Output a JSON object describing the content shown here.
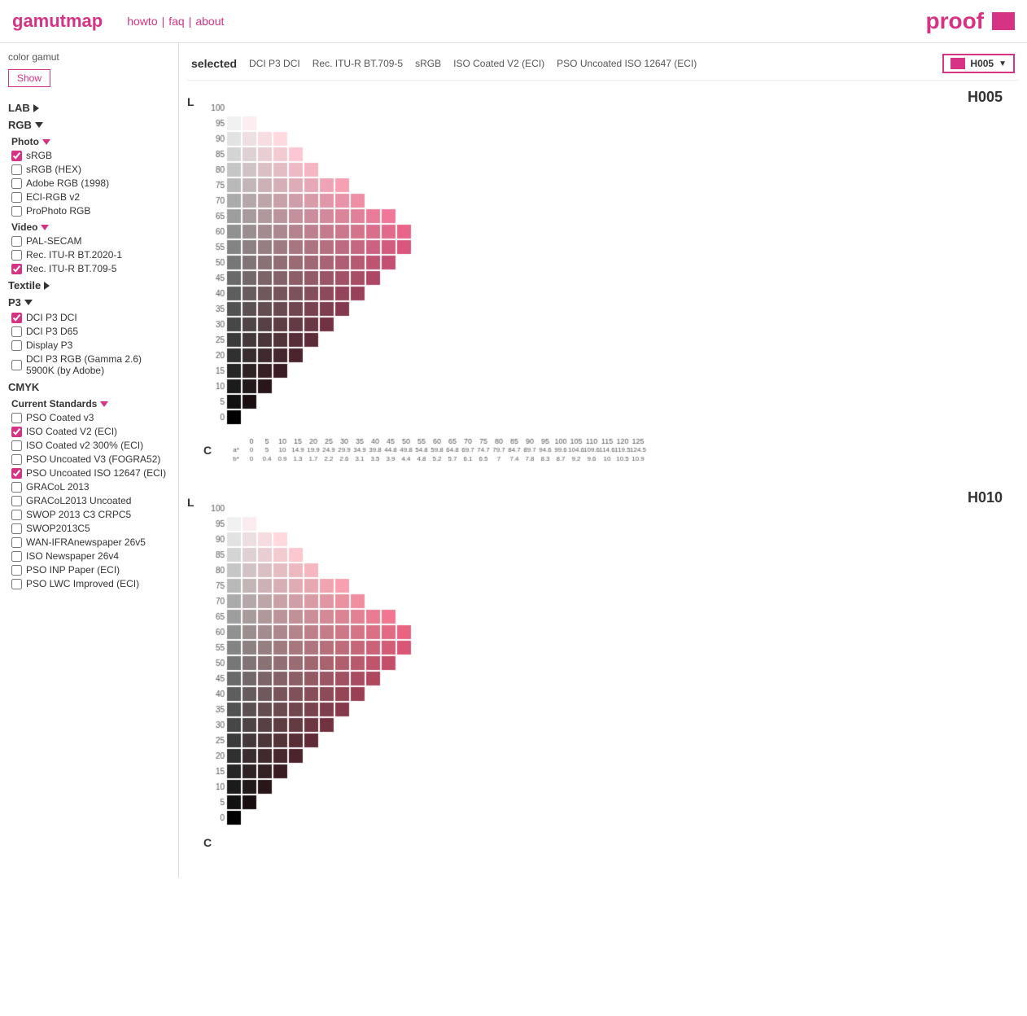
{
  "app": {
    "logo": "gamutmap",
    "nav": {
      "howto": "howto",
      "sep1": "|",
      "faq": "faq",
      "sep2": "|",
      "about": "about"
    },
    "proof": "proof"
  },
  "header": {
    "color_gamut_label": "color gamut",
    "show_button": "Show",
    "selected_label": "selected",
    "gamut_tags": [
      "DCI P3 DCI",
      "Rec. ITU-R BT.709-5",
      "sRGB",
      "ISO Coated V2 (ECI)",
      "PSO Uncoated ISO 12647 (ECI)"
    ],
    "hue_selector": {
      "label": "H005",
      "arrow": "▼"
    }
  },
  "sidebar": {
    "sections": [
      {
        "name": "LAB",
        "expanded": false,
        "arrow": "right"
      },
      {
        "name": "RGB",
        "expanded": true,
        "arrow": "down",
        "subsections": [
          {
            "name": "Photo",
            "expanded": true,
            "arrow": "down-pink",
            "items": [
              {
                "label": "sRGB",
                "checked": true
              },
              {
                "label": "sRGB (HEX)",
                "checked": false
              },
              {
                "label": "Adobe RGB (1998)",
                "checked": false
              },
              {
                "label": "ECI-RGB v2",
                "checked": false
              },
              {
                "label": "ProPhoto RGB",
                "checked": false
              }
            ]
          },
          {
            "name": "Video",
            "expanded": true,
            "arrow": "down-pink",
            "items": [
              {
                "label": "PAL-SECAM",
                "checked": false
              },
              {
                "label": "Rec. ITU-R BT.2020-1",
                "checked": false
              },
              {
                "label": "Rec. ITU-R BT.709-5",
                "checked": true
              }
            ]
          },
          {
            "name": "Textile",
            "expanded": false,
            "arrow": "right"
          }
        ]
      },
      {
        "name": "P3",
        "expanded": true,
        "arrow": "down",
        "items": [
          {
            "label": "DCI P3 DCI",
            "checked": true
          },
          {
            "label": "DCI P3 D65",
            "checked": false
          },
          {
            "label": "Display P3",
            "checked": false
          },
          {
            "label": "DCI P3 RGB (Gamma 2.6) 5900K (by Adobe)",
            "checked": false
          }
        ]
      },
      {
        "name": "CMYK",
        "expanded": true,
        "subsections": [
          {
            "name": "Current Standards",
            "expanded": true,
            "arrow": "down-pink",
            "items": [
              {
                "label": "PSO Coated v3",
                "checked": false
              },
              {
                "label": "ISO Coated V2 (ECI)",
                "checked": true
              },
              {
                "label": "ISO Coated v2 300% (ECI)",
                "checked": false
              },
              {
                "label": "PSO Uncoated V3 (FOGRA52)",
                "checked": false
              },
              {
                "label": "PSO Uncoated ISO 12647 (ECI)",
                "checked": true
              },
              {
                "label": "GRACoL 2013",
                "checked": false
              },
              {
                "label": "GRACoL2013 Uncoated",
                "checked": false
              },
              {
                "label": "SWOP 2013 C3 CRPC5",
                "checked": false
              },
              {
                "label": "SWOP2013C5",
                "checked": false
              },
              {
                "label": "WAN-IFRAnewspaper 26v5",
                "checked": false
              },
              {
                "label": "ISO Newspaper 26v4",
                "checked": false
              },
              {
                "label": "PSO INP Paper (ECI)",
                "checked": false
              },
              {
                "label": "PSO LWC Improved (ECI)",
                "checked": false
              }
            ]
          }
        ]
      }
    ]
  },
  "charts": [
    {
      "id": "H005",
      "title": "H005",
      "axis_l": "L",
      "axis_c": "C",
      "y_ticks": [
        100,
        95,
        90,
        85,
        80,
        75,
        70,
        65,
        60,
        55,
        50,
        45,
        40,
        35,
        30,
        25,
        20,
        15,
        10,
        5,
        0
      ],
      "x_ticks": [
        0,
        5,
        10,
        15,
        20,
        25,
        30,
        35,
        40,
        45,
        50,
        55,
        60,
        65,
        70,
        75,
        80,
        85,
        90,
        95,
        100,
        105,
        110,
        115,
        120,
        125
      ],
      "x_a_star": [
        0,
        5.0,
        10.0,
        14.9,
        19.9,
        24.9,
        29.9,
        34.9,
        39.8,
        44.8,
        49.8,
        54.8,
        59.8,
        64.8,
        69.7,
        74.7,
        79.7,
        84.7,
        89.7,
        94.6,
        99.6,
        104.6,
        109.6,
        114.6,
        119.5,
        124.5
      ],
      "x_b_star": [
        0,
        0.4,
        0.9,
        1.3,
        1.7,
        2.2,
        2.6,
        3.1,
        3.5,
        3.9,
        4.4,
        4.8,
        5.2,
        5.7,
        6.1,
        6.5,
        7.0,
        7.4,
        7.8,
        8.3,
        8.7,
        9.2,
        9.6,
        10.0,
        10.5,
        10.9
      ]
    },
    {
      "id": "H010",
      "title": "H010",
      "axis_l": "L",
      "axis_c": "C"
    }
  ]
}
